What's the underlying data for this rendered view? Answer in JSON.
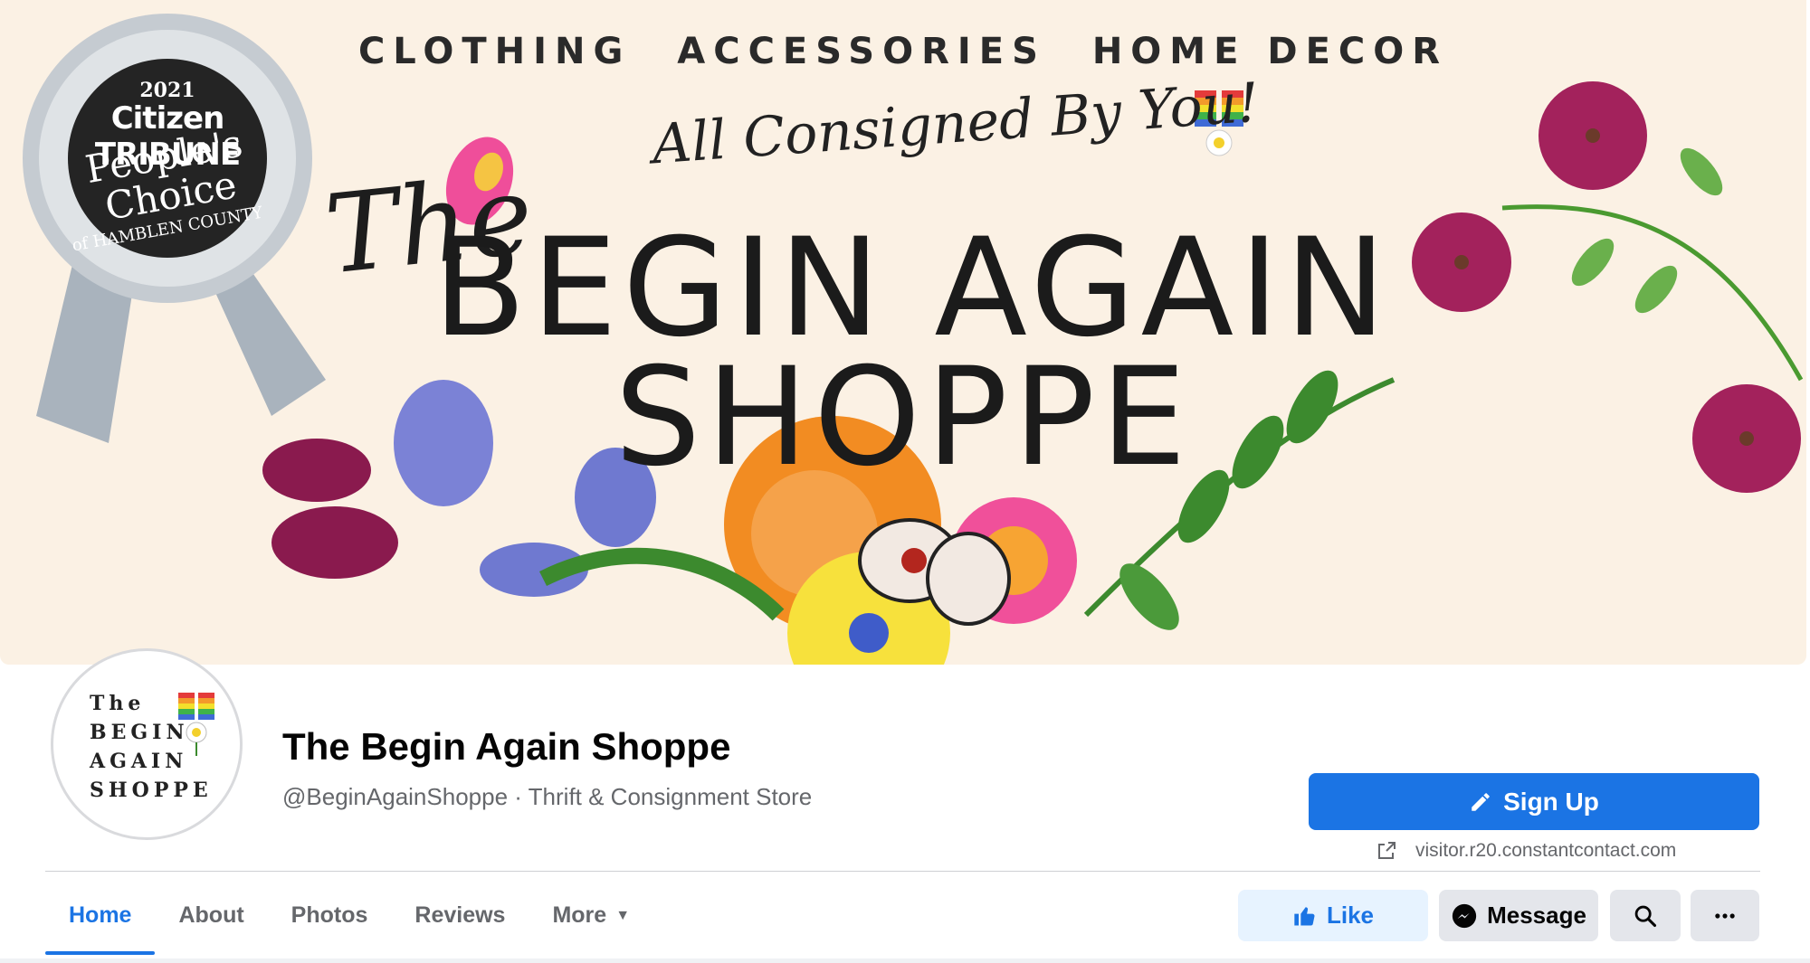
{
  "cover": {
    "tagline": [
      "CLOTHING",
      "ACCESSORIES",
      "HOME DECOR"
    ],
    "script": "All Consigned By You!",
    "the": "The",
    "name_line1": "BEGIN AGAIN",
    "name_line2": "SHOPPE",
    "badge": {
      "year": "2021",
      "paper": "Citizen TRIBUNE",
      "award_line1": "People's",
      "award_line2": "Choice",
      "county": "of HAMBLEN COUNTY"
    }
  },
  "avatar": {
    "lines": [
      "The",
      "BEGIN",
      "AGAIN",
      "SHOPPE"
    ]
  },
  "page": {
    "name": "The Begin Again Shoppe",
    "handle_category": "@BeginAgainShoppe · Thrift & Consignment Store"
  },
  "signup": {
    "label": "Sign Up",
    "link": "visitor.r20.constantcontact.com"
  },
  "tabs": [
    {
      "label": "Home",
      "active": true
    },
    {
      "label": "About"
    },
    {
      "label": "Photos"
    },
    {
      "label": "Reviews"
    },
    {
      "label": "More"
    }
  ],
  "actions": {
    "like": "Like",
    "message": "Message"
  },
  "colors": {
    "accent": "#1b74e4",
    "cover_bg": "#fbf1e4",
    "secondary_text": "#65676b"
  }
}
